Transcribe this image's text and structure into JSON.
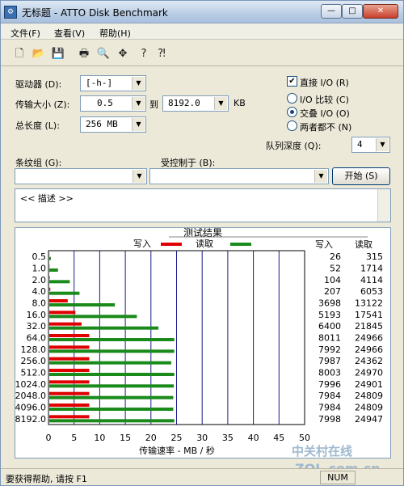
{
  "window": {
    "title": "无标题 - ATTO Disk Benchmark",
    "min": "—",
    "max": "□",
    "close": "✕"
  },
  "menu": [
    "文件(F)",
    "查看(V)",
    "帮助(H)"
  ],
  "toolbar": [
    "new-icon",
    "open-icon",
    "save-icon",
    "print-icon",
    "print-preview-icon",
    "move-icon",
    "help-icon",
    "context-help-icon"
  ],
  "settings": {
    "drive_label": "驱动器 (D):",
    "drive_value": "[-h-]",
    "transfer_label": "传输大小 (Z):",
    "transfer_from": "0.5",
    "to_label": "到",
    "transfer_to": "8192.0",
    "kb_label": "KB",
    "total_label": "总长度 (L):",
    "total_value": "256 MB",
    "direct_io_label": "直接 I/O (R)",
    "direct_io_checked": true,
    "io_compare_label": "I/O 比较 (C)",
    "overlap_io_label": "交叠 I/O (O)",
    "neither_label": "两者都不 (N)",
    "queue_label": "队列深度 (Q):",
    "queue_value": "4",
    "stripe_label": "条纹组 (G):",
    "controlled_label": "受控制于 (B):",
    "start_label": "开始 (S)",
    "desc_text": "<< 描述 >>"
  },
  "chart_data": {
    "type": "bar",
    "orientation": "horizontal",
    "title": "测试结果",
    "xlabel": "传输速率 - MB / 秒",
    "xlim": [
      0,
      50
    ],
    "xticks": [
      "0",
      "5",
      "10",
      "15",
      "20",
      "25",
      "30",
      "35",
      "40",
      "45",
      "50"
    ],
    "grid": true,
    "legend_write": "写入",
    "legend_read": "读取",
    "col_write": "写入",
    "col_read": "读取",
    "colors": {
      "write": "#e00000",
      "read": "#1a8a1a",
      "grid": "#1a1a8c"
    },
    "categories": [
      "0.5",
      "1.0",
      "2.0",
      "4.0",
      "8.0",
      "16.0",
      "32.0",
      "64.0",
      "128.0",
      "256.0",
      "512.0",
      "1024.0",
      "2048.0",
      "4096.0",
      "8192.0"
    ],
    "write_values": [
      0.03,
      0.05,
      0.1,
      0.2,
      3.6,
      5.1,
      6.3,
      7.8,
      7.8,
      7.8,
      7.8,
      7.8,
      7.8,
      7.8,
      7.8
    ],
    "read_values": [
      0.3,
      1.7,
      4.0,
      5.9,
      12.8,
      17.1,
      21.3,
      24.4,
      24.4,
      23.8,
      24.4,
      24.3,
      24.2,
      24.2,
      24.4
    ],
    "write_text": [
      "26",
      "52",
      "104",
      "207",
      "3698",
      "5193",
      "6400",
      "8011",
      "7992",
      "7987",
      "8003",
      "7996",
      "7984",
      "7984",
      "7998"
    ],
    "read_text": [
      "315",
      "1714",
      "4114",
      "6053",
      "13122",
      "17541",
      "21845",
      "24966",
      "24966",
      "24362",
      "24970",
      "24901",
      "24809",
      "24809",
      "24947"
    ]
  },
  "status": {
    "help": "要获得帮助, 请按 F1",
    "num": "NUM"
  },
  "watermark": {
    "brand": "中关村在线",
    "url": "ZOL.com.cn"
  }
}
